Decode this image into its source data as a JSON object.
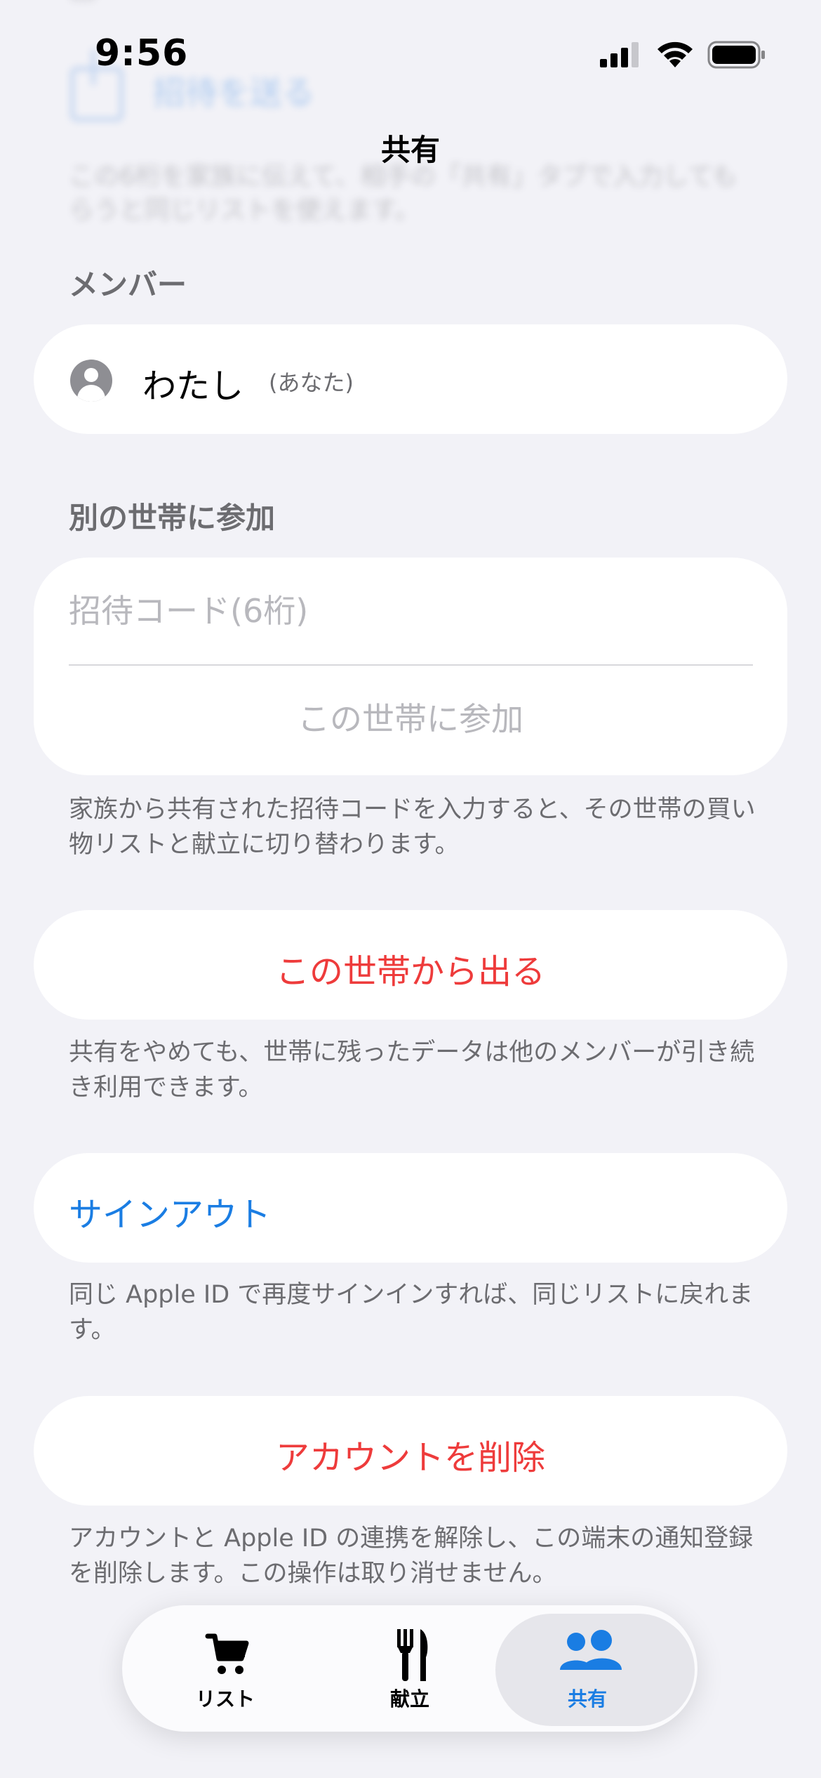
{
  "status_bar": {
    "time": "9:56",
    "signal_icon": "cellular-signal-icon",
    "wifi_icon": "wifi-icon",
    "battery_icon": "battery-full-icon"
  },
  "ghost": {
    "link_label": "招待を送る",
    "description": "この6桁を家族に伝えて、相手の「共有」タブで入力してもらうと同じリストを使えます。"
  },
  "nav": {
    "title": "共有"
  },
  "members": {
    "header": "メンバー",
    "items": [
      {
        "name": "わたし",
        "tag": "(あなた)",
        "icon": "person-circle-icon"
      }
    ]
  },
  "join": {
    "header": "別の世帯に参加",
    "code_placeholder": "招待コード(6桁)",
    "code_value": "",
    "join_button": "この世帯に参加",
    "footer": "家族から共有された招待コードを入力すると、その世帯の買い物リストと献立に切り替わります。"
  },
  "leave": {
    "button": "この世帯から出る",
    "footer": "共有をやめても、世帯に残ったデータは他のメンバーが引き続き利用できます。"
  },
  "signout": {
    "button": "サインアウト",
    "footer": "同じ Apple ID で再度サインインすれば、同じリストに戻れます。"
  },
  "delete_account": {
    "button": "アカウントを削除",
    "footer": "アカウントと Apple ID の連携を解除し、この端末の通知登録を削除します。この操作は取り消せません。"
  },
  "tab_bar": {
    "tabs": [
      {
        "label": "リスト",
        "icon": "cart-icon",
        "selected": false
      },
      {
        "label": "献立",
        "icon": "fork-knife-icon",
        "selected": false
      },
      {
        "label": "共有",
        "icon": "people-icon",
        "selected": true
      }
    ]
  },
  "colors": {
    "background": "#f2f2f7",
    "accent_blue": "#1a7de3",
    "destructive_red": "#ee3b3b",
    "secondary_text": "#6c6c70",
    "placeholder": "#b8b8bd"
  }
}
